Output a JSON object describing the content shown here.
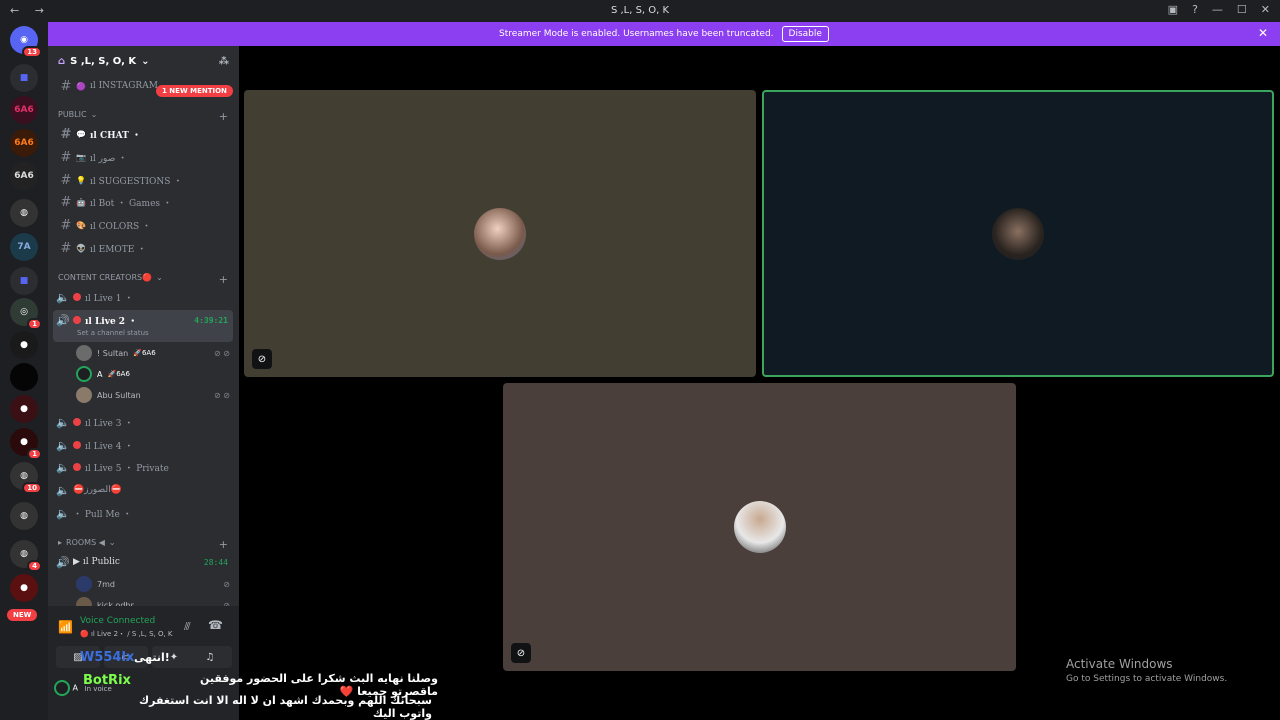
{
  "window": {
    "title": "S ,L, S, O, K",
    "nav": "← →"
  },
  "guilds": {
    "dm_badge": "13",
    "badges": [
      "1",
      "1",
      "10",
      "4"
    ],
    "new_label": "NEW",
    "icon_labels": [
      "6A6",
      "6A6",
      "6A6",
      "7A"
    ]
  },
  "banner": {
    "text": "Streamer Mode is enabled. Usernames have been truncated.",
    "button": "Disable"
  },
  "server": {
    "name": "S ,L, S, O, K"
  },
  "mention_pill": "1 NEW MENTION",
  "channels": {
    "top": "ıl INSTAGRAM",
    "public_cat": "PUBLIC",
    "text": [
      {
        "emoji": "💬",
        "name": "ıl CHAT ・",
        "bold": true
      },
      {
        "emoji": "📷",
        "name": "ıl صور ・",
        "bold": false
      },
      {
        "emoji": "💡",
        "name": "ıl SUGGESTIONS ・",
        "bold": false
      },
      {
        "emoji": "🤖",
        "name": "ıl Bot ・ Games ・",
        "bold": false
      },
      {
        "emoji": "🎨",
        "name": "ıl COLORS ・",
        "bold": false
      },
      {
        "emoji": "👽",
        "name": "ıl EMOTE ・",
        "bold": false
      }
    ],
    "creators_cat": "CONTENT CREATORS🔴",
    "voice": [
      {
        "name": "ıl Live 1 ・"
      },
      {
        "name": "ıl Live 2 ・",
        "timer": "4:39:21",
        "status": "Set a channel status"
      },
      {
        "name": "ıl Live 3 ・"
      },
      {
        "name": "ıl Live 4 ・"
      },
      {
        "name": "ıl Live 5 ・ Private"
      },
      {
        "name": "⛔الصورز⛔"
      },
      {
        "name": "・ Pull Me ・"
      }
    ],
    "live2_users": [
      {
        "name": "! Sultan",
        "tag": "🚀6A6"
      },
      {
        "name": "A",
        "tag": "🚀6A6"
      },
      {
        "name": "Abu Sultan",
        "tag": ""
      }
    ],
    "rooms_cat": "ROOMS ◀",
    "public_voice": {
      "name": "ıl Public",
      "timer": "28:44"
    },
    "public_users": [
      {
        "name": "7md"
      },
      {
        "name": "kick odhr"
      }
    ]
  },
  "voice_panel": {
    "status": "Voice Connected",
    "sub": "🔴 ıl Live 2・ / S ,L, S, O, K",
    "user": "A",
    "user_sub": "In voice"
  },
  "tiles_colors": {
    "t1": "#423e31",
    "t2": "#0f1a22",
    "t3": "#4a3f3a",
    "border2": "#3ba55d"
  },
  "overlay": {
    "name1": "W554lx",
    "name2": "BotRix",
    "name3": "انتهى!",
    "line1": "وصلنا نهايه البث شكرا على الحضور موفقين ماقصرتو جميعا ❤️",
    "line2": "سبحانك اللهم وبحمدك اشهد ان لا اله الا انت استغفرك واتوب اليك"
  },
  "watermark": {
    "title": "Activate Windows",
    "sub": "Go to Settings to activate Windows."
  }
}
